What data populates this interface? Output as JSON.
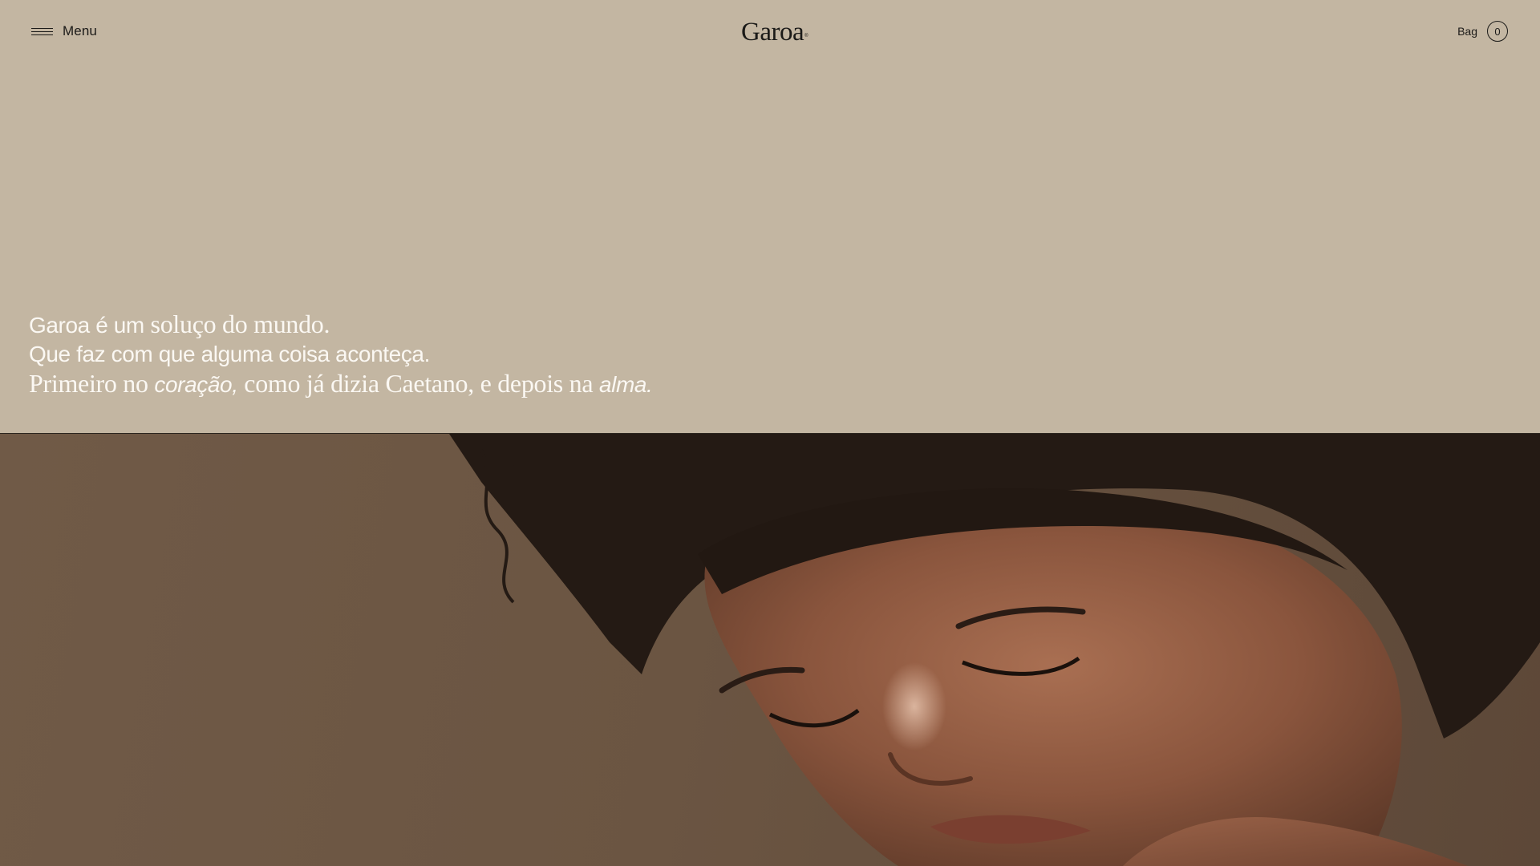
{
  "header": {
    "menu_label": "Menu",
    "logo_text": "Garoa",
    "logo_mark": "®",
    "bag_label": "Bag",
    "bag_count": "0"
  },
  "intro": {
    "line1_sans_a": "Garoa é um",
    "line1_serif": " soluço do mundo.",
    "line2": "Que faz com que alguma coisa aconteça.",
    "line3_serif_a": "Primeiro no ",
    "line3_italic_a": "coração,",
    "line3_serif_b": " como já dizia Caetano, e depois na ",
    "line3_italic_b": "alma."
  },
  "icons": {
    "menu": "hamburger-icon"
  },
  "colors": {
    "background": "#c3b6a2",
    "text_dark": "#1b1a18",
    "text_light": "#fbf8f3",
    "hero_bg": "#6b5542"
  },
  "hero": {
    "image_subject": "close-up portrait of a woman with curly dark hair looking down"
  }
}
